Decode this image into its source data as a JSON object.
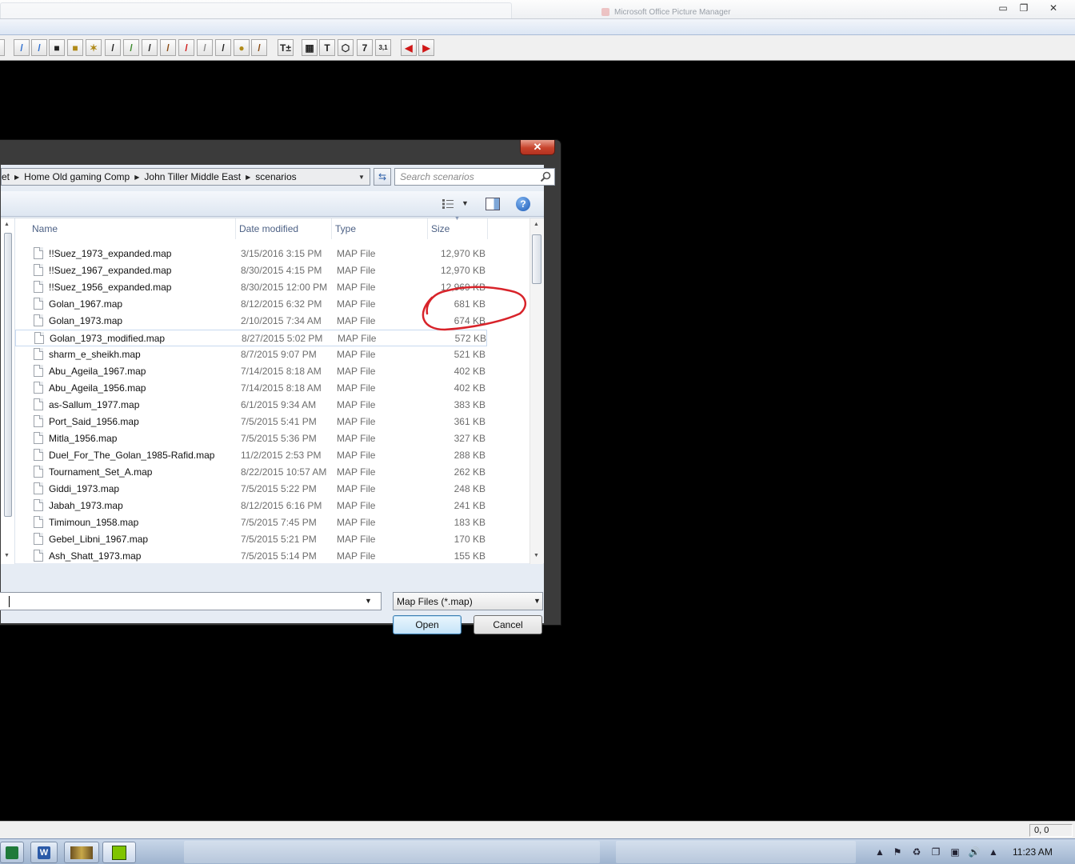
{
  "dialog": {
    "close_label": "✕",
    "breadcrumb": [
      "et",
      "Home Old gaming Comp",
      "John Tiller Middle East",
      "scenarios"
    ],
    "search_placeholder": "Search scenarios",
    "columns": [
      "Name",
      "Date modified",
      "Type",
      "Size"
    ],
    "files": [
      {
        "name": "!!Suez_1973_expanded.map",
        "date": "3/15/2016 3:15 PM",
        "type": "MAP File",
        "size": "12,970 KB"
      },
      {
        "name": "!!Suez_1967_expanded.map",
        "date": "8/30/2015 4:15 PM",
        "type": "MAP File",
        "size": "12,970 KB"
      },
      {
        "name": "!!Suez_1956_expanded.map",
        "date": "8/30/2015 12:00 PM",
        "type": "MAP File",
        "size": "12,969 KB"
      },
      {
        "name": "Golan_1967.map",
        "date": "8/12/2015 6:32 PM",
        "type": "MAP File",
        "size": "681 KB"
      },
      {
        "name": "Golan_1973.map",
        "date": "2/10/2015 7:34 AM",
        "type": "MAP File",
        "size": "674 KB"
      },
      {
        "name": "Golan_1973_modified.map",
        "date": "8/27/2015 5:02 PM",
        "type": "MAP File",
        "size": "572 KB"
      },
      {
        "name": "sharm_e_sheikh.map",
        "date": "8/7/2015 9:07 PM",
        "type": "MAP File",
        "size": "521 KB"
      },
      {
        "name": "Abu_Ageila_1967.map",
        "date": "7/14/2015 8:18 AM",
        "type": "MAP File",
        "size": "402 KB"
      },
      {
        "name": "Abu_Ageila_1956.map",
        "date": "7/14/2015 8:18 AM",
        "type": "MAP File",
        "size": "402 KB"
      },
      {
        "name": "as-Sallum_1977.map",
        "date": "6/1/2015 9:34 AM",
        "type": "MAP File",
        "size": "383 KB"
      },
      {
        "name": "Port_Said_1956.map",
        "date": "7/5/2015 5:41 PM",
        "type": "MAP File",
        "size": "361 KB"
      },
      {
        "name": "Mitla_1956.map",
        "date": "7/5/2015 5:36 PM",
        "type": "MAP File",
        "size": "327 KB"
      },
      {
        "name": "Duel_For_The_Golan_1985-Rafid.map",
        "date": "11/2/2015 2:53 PM",
        "type": "MAP File",
        "size": "288 KB"
      },
      {
        "name": "Tournament_Set_A.map",
        "date": "8/22/2015 10:57 AM",
        "type": "MAP File",
        "size": "262 KB"
      },
      {
        "name": "Giddi_1973.map",
        "date": "7/5/2015 5:22 PM",
        "type": "MAP File",
        "size": "248 KB"
      },
      {
        "name": "Jabah_1973.map",
        "date": "8/12/2015 6:16 PM",
        "type": "MAP File",
        "size": "241 KB"
      },
      {
        "name": "Timimoun_1958.map",
        "date": "7/5/2015 7:45 PM",
        "type": "MAP File",
        "size": "183 KB"
      },
      {
        "name": "Gebel_Libni_1967.map",
        "date": "7/5/2015 5:21 PM",
        "type": "MAP File",
        "size": "170 KB"
      },
      {
        "name": "Ash_Shatt_1973.map",
        "date": "7/5/2015 5:14 PM",
        "type": "MAP File",
        "size": "155 KB"
      }
    ],
    "selected_index": 5,
    "filename_value": "",
    "filetype_value": "Map Files (*.map)",
    "open_label": "Open",
    "cancel_label": "Cancel",
    "annotation_color": "#d8232a",
    "filename_label_stub": ":"
  },
  "toolbar": {
    "icons": [
      "bracket-icon",
      "blue-unit-icon",
      "blue-diagonal-icon",
      "black-unit-icon",
      "yellow-unit-icon",
      "yellow-marker-icon",
      "burst-icon",
      "green-pencil-icon",
      "railroad-icon",
      "orange-road-icon",
      "red-road-icon",
      "gray-road-icon",
      "dark-road-icon",
      "tan-feature-icon",
      "brown-road-icon",
      "text-plus-icon",
      "map-edit-icon",
      "text-icon",
      "hex-icon",
      "number-icon",
      "fraction-icon",
      "red-left-arrow-icon",
      "red-right-arrow-icon"
    ],
    "glyphs": [
      ")",
      "/",
      "/",
      "■",
      "■",
      "✶",
      "/",
      "/",
      "/",
      "/",
      "/",
      "/",
      "/",
      "●",
      "/",
      "T±",
      "▦",
      "T",
      "⬡",
      "7",
      "3,1",
      "◀",
      "▶"
    ]
  },
  "window": {
    "minimize": "▭",
    "restore": "❐",
    "close": "✕",
    "ghost_title": "Microsoft Office Picture Manager"
  },
  "status": {
    "coords": "0, 0"
  },
  "taskbar": {
    "clock": "11:23 AM"
  }
}
